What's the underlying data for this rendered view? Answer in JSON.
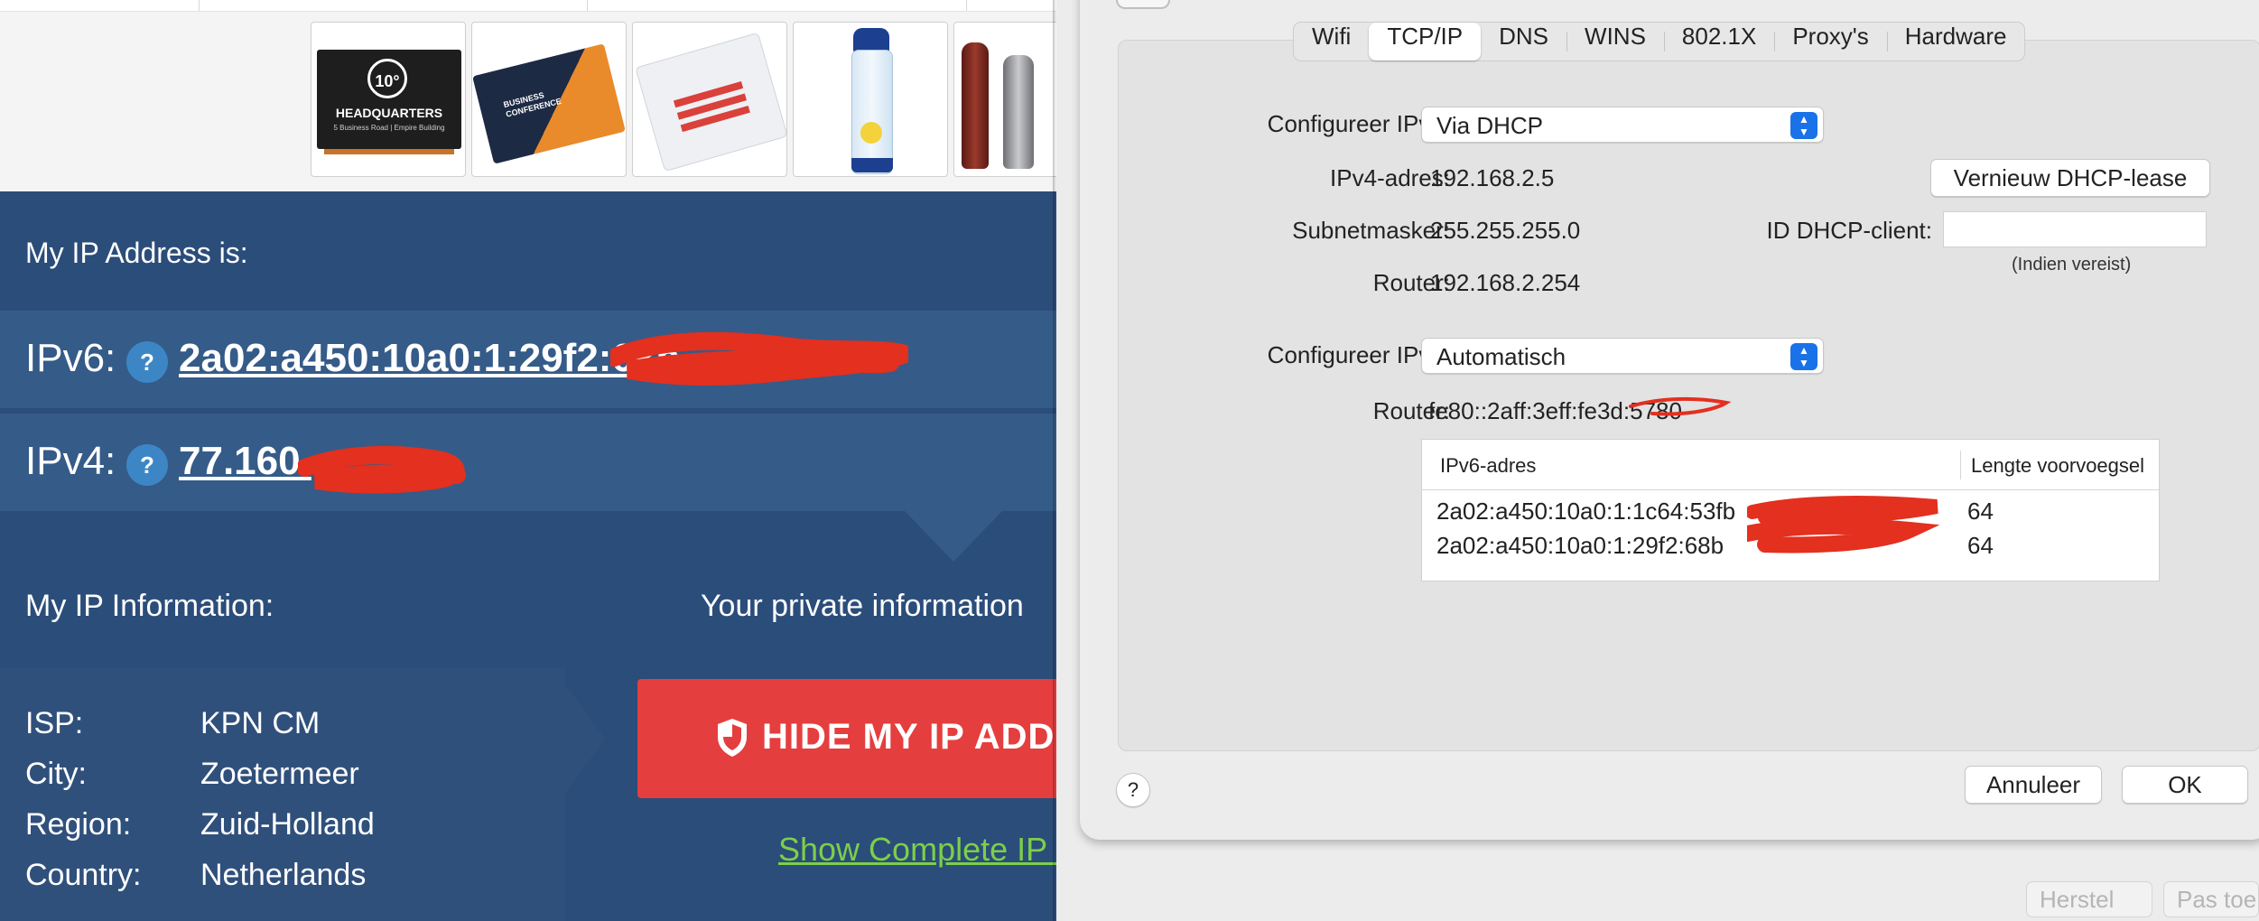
{
  "webpage": {
    "ip_heading": "My IP Address is:",
    "ipv6": {
      "label": "IPv6:",
      "help": "?",
      "value": "2a02:a450:10a0:1:29f2:68b"
    },
    "ipv4": {
      "label": "IPv4:",
      "help": "?",
      "value": "77.160."
    },
    "info_heading": "My IP Information:",
    "private_heading": "Your private information",
    "info": [
      {
        "key": "ISP:",
        "value": "KPN CM"
      },
      {
        "key": "City:",
        "value": "Zoetermeer"
      },
      {
        "key": "Region:",
        "value": "Zuid-Holland"
      },
      {
        "key": "Country:",
        "value": "Netherlands"
      }
    ],
    "hide_button": "HIDE MY IP ADDR",
    "show_link": "Show Complete IP D",
    "thumbnail_text": {
      "headquarters_badge": "10°",
      "headquarters": "HEADQUARTERS",
      "headquarters_address": "5 Business Road | Empire Building",
      "conference": "BUSINESS CONFERENCE"
    },
    "colors": {
      "background": "#2b4d7a",
      "row": "#355b88",
      "accent_red": "#e53e3e",
      "link_green": "#7ccf4a"
    }
  },
  "dialog": {
    "tabs": [
      {
        "label": "Wifi"
      },
      {
        "label": "TCP/IP"
      },
      {
        "label": "DNS"
      },
      {
        "label": "WINS"
      },
      {
        "label": "802.1X"
      },
      {
        "label": "Proxy's"
      },
      {
        "label": "Hardware"
      }
    ],
    "active_tab": "TCP/IP",
    "ipv4_config": {
      "label": "Configureer IPv4:",
      "value": "Via DHCP"
    },
    "ipv4_address": {
      "label": "IPv4-adres:",
      "value": "192.168.2.5"
    },
    "renew_button": "Vernieuw DHCP-lease",
    "subnet": {
      "label": "Subnetmasker:",
      "value": "255.255.255.0"
    },
    "dhcp_client": {
      "label": "ID DHCP-client:",
      "value": "",
      "hint": "(Indien vereist)"
    },
    "router4": {
      "label": "Router:",
      "value": "192.168.2.254"
    },
    "ipv6_config": {
      "label": "Configureer IPv6:",
      "value": "Automatisch"
    },
    "router6": {
      "label": "Router:",
      "value": "fe80::2aff:3eff:fe3d:5780"
    },
    "ipv6_table": {
      "columns": [
        "IPv6-adres",
        "Lengte voorvoegsel"
      ],
      "rows": [
        {
          "address": "2a02:a450:10a0:1:1c64:53fb",
          "prefix": "64"
        },
        {
          "address": "2a02:a450:10a0:1:29f2:68b",
          "prefix": "64"
        }
      ]
    },
    "help": "?",
    "cancel_button": "Annuleer",
    "ok_button": "OK",
    "background_buttons": [
      "Herstel",
      "Pas toe"
    ],
    "accent": "#1a72e8"
  }
}
